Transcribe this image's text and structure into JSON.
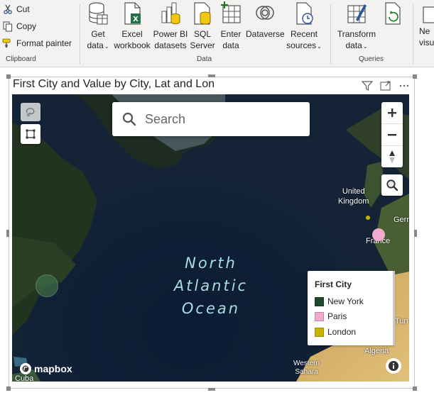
{
  "ribbon": {
    "clipboard": {
      "cut": "Cut",
      "copy": "Copy",
      "format_painter": "Format painter",
      "group_label": "Clipboard"
    },
    "data": {
      "get_data": [
        "Get",
        "data"
      ],
      "excel_workbook": [
        "Excel",
        "workbook"
      ],
      "power_bi_datasets": [
        "Power BI",
        "datasets"
      ],
      "sql_server": [
        "SQL",
        "Server"
      ],
      "enter_data": [
        "Enter",
        "data"
      ],
      "dataverse": "Dataverse",
      "recent_sources": [
        "Recent",
        "sources"
      ],
      "group_label": "Data"
    },
    "queries": {
      "transform_data": [
        "Transform",
        "data"
      ],
      "refresh": "Refresh",
      "group_label": "Queries"
    },
    "new_visual_partial": [
      "Ne",
      "visu"
    ]
  },
  "visual": {
    "title": "First City and Value by City, Lat and Lon",
    "map": {
      "search_placeholder": "Search",
      "ocean_label": [
        "North",
        "Atlantic",
        "Ocean"
      ],
      "places": {
        "united_kingdom": [
          "United",
          "Kingdom"
        ],
        "france": "France",
        "germany_partial": "Gern",
        "algeria": "Algeria",
        "western_sahara": [
          "Western",
          "Sahara"
        ],
        "cuba": "Cuba",
        "tunisia_partial": "Tun"
      },
      "attribution": "mapbox"
    },
    "legend": {
      "title": "First City",
      "items": [
        {
          "label": "New York",
          "color": "#1d4a2f"
        },
        {
          "label": "Paris",
          "color": "#f2aacd"
        },
        {
          "label": "London",
          "color": "#c8b400"
        }
      ]
    },
    "markers": {
      "new_york_color": "#3c6b45",
      "paris_color": "#f2aacd",
      "london_color": "#c8b400"
    }
  }
}
